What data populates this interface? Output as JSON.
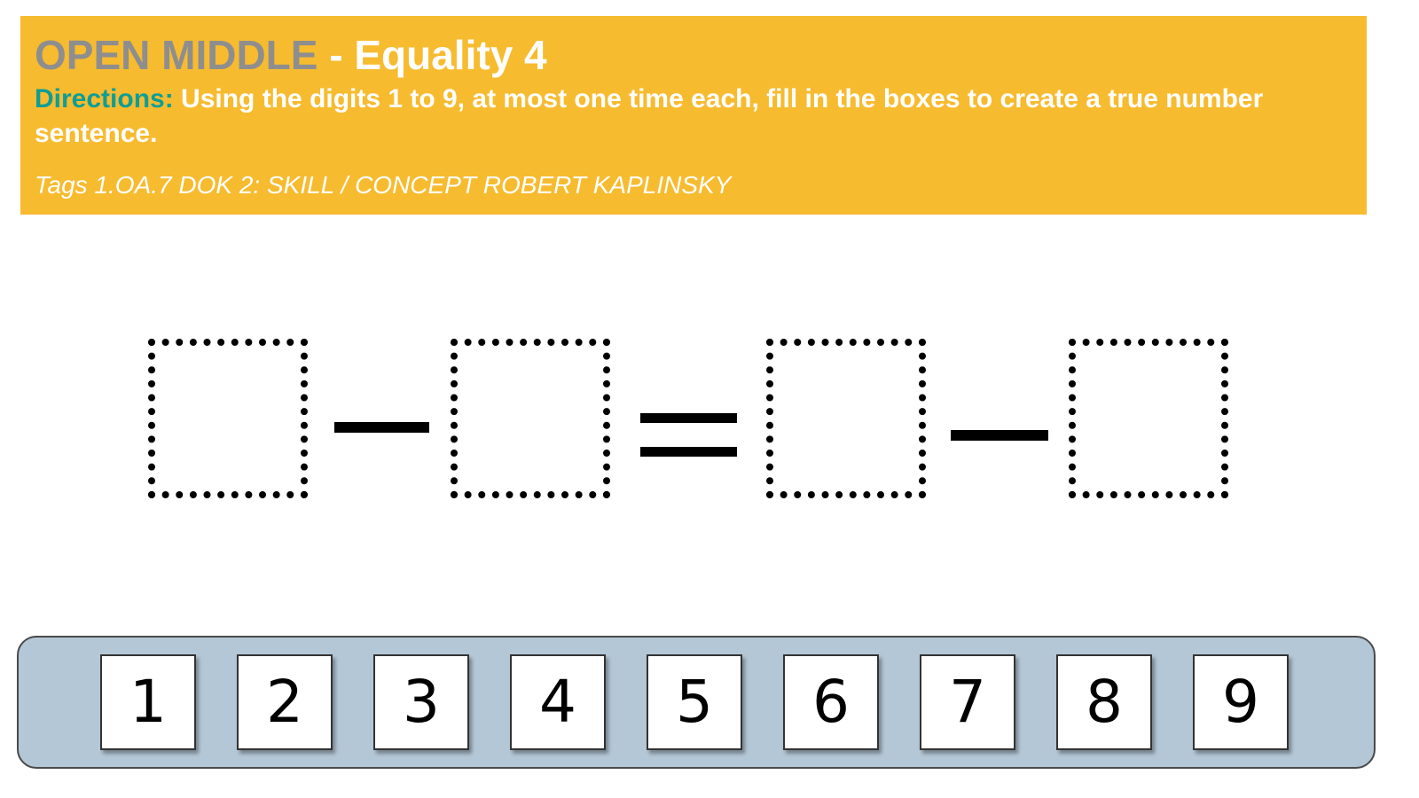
{
  "header": {
    "title_prefix": "OPEN MIDDLE",
    "title_suffix": " - Equality 4",
    "directions_label": "Directions:",
    "directions_text": " Using the digits 1 to 9, at most one time each, fill in the boxes to create a true number sentence.",
    "tags": "Tags 1.OA.7 DOK 2: SKILL / CONCEPT ROBERT KAPLINSKY",
    "background_color": "#F7BB2F",
    "accent_color": "#0E9E95"
  },
  "equation": {
    "boxes": [
      "",
      "",
      "",
      ""
    ],
    "operators": [
      "minus",
      "equals",
      "minus"
    ]
  },
  "tray": {
    "digits": [
      "1",
      "2",
      "3",
      "4",
      "5",
      "6",
      "7",
      "8",
      "9"
    ],
    "background_color": "#B4C7D6"
  }
}
